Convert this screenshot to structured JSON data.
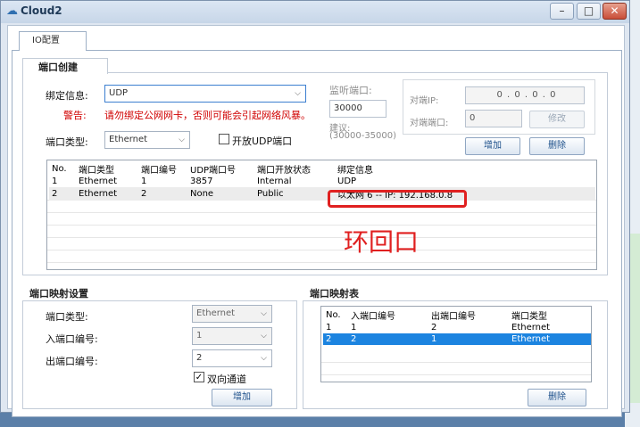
{
  "window": {
    "title": "Cloud2"
  },
  "tabs": [
    "IO配置"
  ],
  "port_create": {
    "group_title": "端口创建",
    "bind_label": "绑定信息:",
    "bind_value": "UDP",
    "warning_label": "警告:",
    "warning_text": "请勿绑定公网网卡，否则可能会引起网络风暴。",
    "port_type_label": "端口类型:",
    "port_type_value": "Ethernet",
    "open_udp_label": "开放UDP端口",
    "listen_port_label": "监听端口:",
    "listen_port_value": "30000",
    "suggest_label": "建议:",
    "suggest_range": "(30000-35000)",
    "peer_ip_label": "对端IP:",
    "peer_ip_value": "0 . 0 . 0 . 0",
    "peer_port_label": "对端端口:",
    "peer_port_value": "0",
    "modify_button": "修改",
    "add_button": "增加",
    "delete_button": "删除"
  },
  "port_table": {
    "columns": [
      "No.",
      "端口类型",
      "端口编号",
      "UDP端口号",
      "端口开放状态",
      "绑定信息"
    ],
    "rows": [
      [
        "1",
        "Ethernet",
        "1",
        "3857",
        "Internal",
        "UDP"
      ],
      [
        "2",
        "Ethernet",
        "2",
        "None",
        "Public",
        "以太网 6 -- IP: 192.168.0.8"
      ]
    ]
  },
  "annotation": {
    "text": "环回口",
    "color": "#e02020"
  },
  "mapping_settings": {
    "group_title": "端口映射设置",
    "port_type_label": "端口类型:",
    "port_type_value": "Ethernet",
    "in_port_label": "入端口编号:",
    "in_port_value": "1",
    "out_port_label": "出端口编号:",
    "out_port_value": "2",
    "bidirectional_label": "双向通道",
    "add_button": "增加"
  },
  "mapping_table": {
    "group_title": "端口映射表",
    "columns": [
      "No.",
      "入端口编号",
      "出端口编号",
      "端口类型"
    ],
    "rows": [
      [
        "1",
        "1",
        "2",
        "Ethernet"
      ],
      [
        "2",
        "2",
        "1",
        "Ethernet"
      ]
    ],
    "delete_button": "删除"
  },
  "colors": {
    "selection": "#1c84e0",
    "highlight_box": "#e02020"
  }
}
